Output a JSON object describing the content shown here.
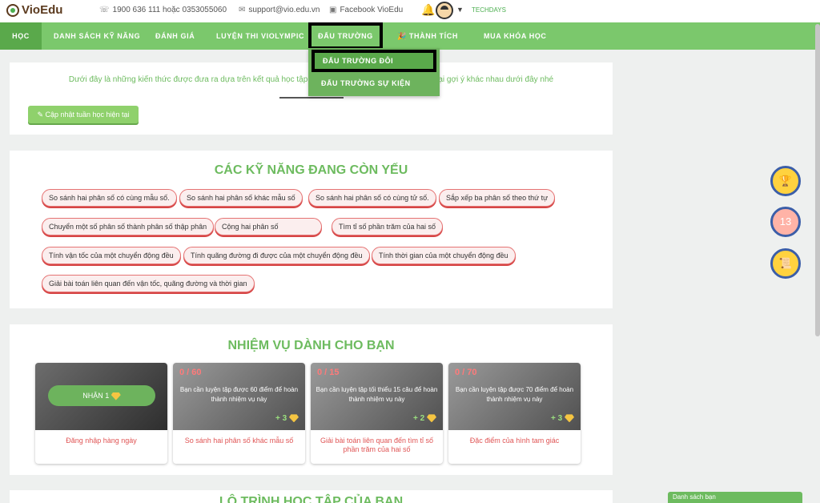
{
  "header": {
    "logo": "VioEdu",
    "phone": "1900 636 111 hoặc 0353055060",
    "email": "support@vio.edu.vn",
    "facebook": "Facebook VioEdu",
    "username": "TECHDAYS"
  },
  "nav": {
    "items": [
      "HỌC",
      "DANH SÁCH KỸ NĂNG",
      "ĐÁNH GIÁ",
      "LUYỆN THI VIOLYMPIC",
      "ĐẤU TRƯỜNG",
      "THÀNH TÍCH",
      "MUA KHÓA HỌC"
    ],
    "active": "HỌC",
    "dropdown": [
      "ĐẤU TRƯỜNG ĐÔI",
      "ĐẤU TRƯỜNG SỰ KIỆN"
    ]
  },
  "intro": {
    "text_left": "Dưới đây là những kiến thức được đưa ra dựa trên kết quả học tập và kiế",
    "text_right": "g loại gợi ý khác nhau dưới đây nhé",
    "update_button": "Cập nhật tuần học hiện tại"
  },
  "weak_skills": {
    "title": "CÁC KỸ NĂNG ĐANG CÒN YẾU",
    "items": [
      "So sánh hai phân số có cùng mẫu số.",
      "So sánh hai phân số khác mẫu số",
      "So sánh hai phân số có cùng tử số.",
      "Sắp xếp ba phân số theo thứ tự",
      "Chuyển một số phân số thành phân số thập phân",
      "Cộng hai phân số",
      "Tìm tỉ số phần trăm của hai số",
      "Tính vận tốc của một chuyển động đều",
      "Tính quãng đường đi được của một chuyển động đều",
      "Tính thời gian của một chuyển động đều",
      "Giải bài toán liên quan đến vận tốc, quãng đường và thời gian"
    ]
  },
  "missions": {
    "title": "NHIỆM VỤ DÀNH CHO BẠN",
    "claim_label": "NHẬN 1",
    "cards": [
      {
        "progress": "",
        "desc": "",
        "reward": "",
        "title": "Đăng nhập hàng ngày"
      },
      {
        "progress": "0 / 60",
        "desc": "Bạn cần luyện tập được 60 điểm để hoàn thành nhiệm vụ này",
        "reward": "+ 3",
        "title": "So sánh hai phân số khác mẫu số"
      },
      {
        "progress": "0 / 15",
        "desc": "Bạn cần luyện tập tối thiểu 15 câu để hoàn thành nhiệm vụ này",
        "reward": "+ 2",
        "title": "Giải bài toán liên quan đến tìm tỉ số phần trăm của hai số"
      },
      {
        "progress": "0 / 70",
        "desc": "Bạn cần luyện tập được 70 điểm để hoàn thành nhiệm vụ này",
        "reward": "+ 3",
        "title": "Đặc điểm của hình tam giác"
      }
    ]
  },
  "roadmap": {
    "title": "LỘ TRÌNH HỌC TẬP CỦA BẠN"
  },
  "side": {
    "gem_count": "13"
  },
  "friends": {
    "label": "Danh sách bạn"
  }
}
